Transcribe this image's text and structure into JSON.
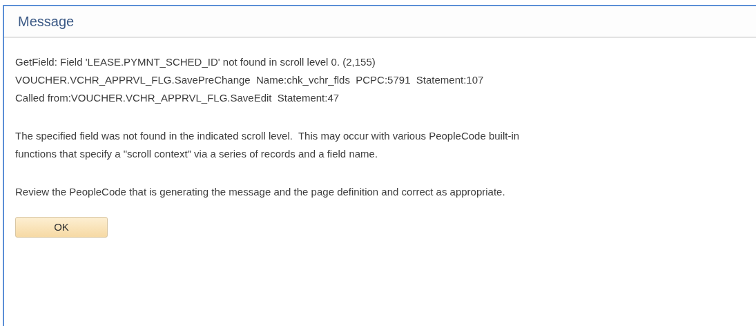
{
  "dialog": {
    "title": "Message",
    "paragraphs": [
      {
        "lines": [
          "GetField: Field 'LEASE.PYMNT_SCHED_ID' not found in scroll level 0. (2,155)",
          "VOUCHER.VCHR_APPRVL_FLG.SavePreChange  Name:chk_vchr_flds  PCPC:5791  Statement:107",
          "Called from:VOUCHER.VCHR_APPRVL_FLG.SaveEdit  Statement:47"
        ]
      },
      {
        "lines": [
          "The specified field was not found in the indicated scroll level.  This may occur with various PeopleCode built-in",
          "functions that specify a \"scroll context\" via a series of records and a field name."
        ]
      },
      {
        "lines": [
          "Review the PeopleCode that is generating the message and the page definition and correct as appropriate."
        ]
      }
    ],
    "buttons": [
      "OK"
    ]
  }
}
